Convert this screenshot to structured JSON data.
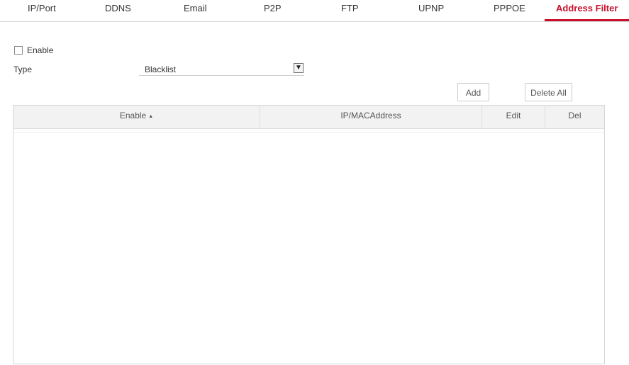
{
  "tabs": [
    {
      "label": "IP/Port",
      "active": false
    },
    {
      "label": "DDNS",
      "active": false
    },
    {
      "label": "Email",
      "active": false
    },
    {
      "label": "P2P",
      "active": false
    },
    {
      "label": "FTP",
      "active": false
    },
    {
      "label": "UPNP",
      "active": false
    },
    {
      "label": "PPPOE",
      "active": false
    },
    {
      "label": "Address Filter",
      "active": true
    }
  ],
  "colors": {
    "accent": "#c8102e",
    "header_bg": "#f2f2f2",
    "border": "#d6d6d6"
  },
  "form": {
    "enable_label": "Enable",
    "enable_checked": false,
    "type_label": "Type",
    "type_value": "Blacklist",
    "type_arrow_icon": "chevron-down-icon"
  },
  "actions": {
    "add_label": "Add",
    "delete_all_label": "Delete All"
  },
  "table": {
    "columns": {
      "enable": "Enable",
      "ip_mac": "IP/MACAddress",
      "edit": "Edit",
      "del": "Del"
    },
    "sort_icon": "sort-up-icon",
    "rows": []
  }
}
